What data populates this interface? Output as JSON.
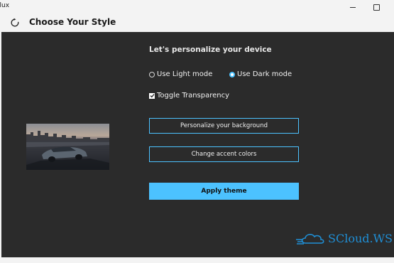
{
  "window": {
    "app_title": "elux",
    "minimize_icon": "minimize-icon",
    "maximize_icon": "maximize-icon"
  },
  "header": {
    "title": "Choose Your Style",
    "refresh_icon": "refresh-icon"
  },
  "main": {
    "heading": "Let's personalize your device",
    "mode_options": [
      {
        "label": "Use Light mode",
        "selected": false
      },
      {
        "label": "Use Dark mode",
        "selected": true
      }
    ],
    "transparency": {
      "label": "Toggle Transparency",
      "checked": true
    },
    "buttons": {
      "background": "Personalize your background",
      "accent": "Change accent colors",
      "apply": "Apply theme"
    }
  },
  "watermark": {
    "text": "SCloud.WS"
  },
  "colors": {
    "accent": "#4cc2ff",
    "panel": "#2b2b2b",
    "chrome": "#f3f3f3"
  }
}
